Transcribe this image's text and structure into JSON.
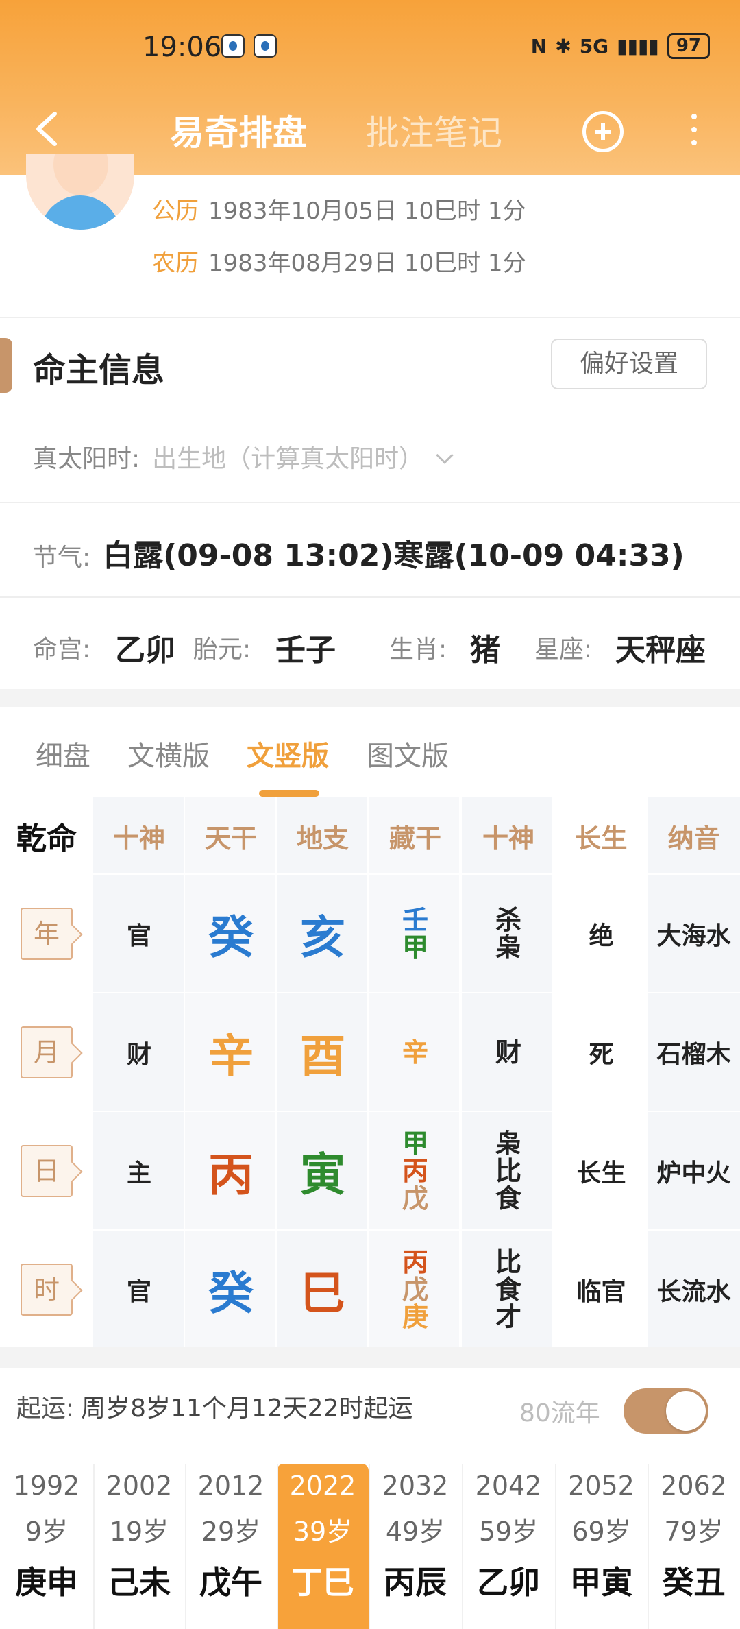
{
  "status_bar": {
    "time": "19:06",
    "network": "5G",
    "battery": "97"
  },
  "nav": {
    "tab_active": "易奇排盘",
    "tab_other": "批注笔记"
  },
  "profile": {
    "solar_label": "公历",
    "solar_value": "1983年10月05日 10巳时 1分",
    "lunar_label": "农历",
    "lunar_value": "1983年08月29日 10巳时 1分"
  },
  "section": {
    "title": "命主信息",
    "pref_button": "偏好设置"
  },
  "solar_time": {
    "label": "真太阳时:",
    "placeholder": "出生地（计算真太阳时）"
  },
  "jieqi": {
    "label": "节气:",
    "value": "白露(09-08 13:02)寒露(10-09 04:33)"
  },
  "info": {
    "minggong_label": "命宫:",
    "minggong": "乙卯",
    "taiyuan_label": "胎元:",
    "taiyuan": "壬子",
    "shengxiao_label": "生肖:",
    "shengxiao": "猪",
    "xingzuo_label": "星座:",
    "xingzuo": "天秤座"
  },
  "tabs": [
    "细盘",
    "文横版",
    "文竖版",
    "图文版"
  ],
  "grid": {
    "corner": "乾命",
    "headers": [
      "十神",
      "天干",
      "地支",
      "藏干",
      "十神",
      "长生",
      "纳音"
    ],
    "rows": [
      {
        "pillar": "年",
        "shishen": "官",
        "gan": "癸",
        "zhi": "亥",
        "canggan": [
          "壬",
          "甲"
        ],
        "shishen2": [
          "杀",
          "枭"
        ],
        "changsheng": "绝",
        "nayin": "大海水"
      },
      {
        "pillar": "月",
        "shishen": "财",
        "gan": "辛",
        "zhi": "酉",
        "canggan": [
          "辛"
        ],
        "shishen2": [
          "财"
        ],
        "changsheng": "死",
        "nayin": "石榴木"
      },
      {
        "pillar": "日",
        "shishen": "主",
        "gan": "丙",
        "zhi": "寅",
        "canggan": [
          "甲",
          "丙",
          "戊"
        ],
        "shishen2": [
          "枭",
          "比",
          "食"
        ],
        "changsheng": "长生",
        "nayin": "炉中火"
      },
      {
        "pillar": "时",
        "shishen": "官",
        "gan": "癸",
        "zhi": "巳",
        "canggan": [
          "丙",
          "戊",
          "庚"
        ],
        "shishen2": [
          "比",
          "食",
          "才"
        ],
        "changsheng": "临官",
        "nayin": "长流水"
      }
    ],
    "colors": {
      "water": "#2a7bd0",
      "metal": "#f0a03c",
      "fire": "#d4541c",
      "wood": "#2e8b2e",
      "earth": "#c7956a"
    }
  },
  "qiyun": {
    "label": "起运:",
    "value": "周岁8岁11个月12天22时起运",
    "liunian": "80流年"
  },
  "dayun": [
    {
      "year": "1992",
      "age": "9岁",
      "ganzhi": "庚申"
    },
    {
      "year": "2002",
      "age": "19岁",
      "ganzhi": "己未"
    },
    {
      "year": "2012",
      "age": "29岁",
      "ganzhi": "戊午"
    },
    {
      "year": "2022",
      "age": "39岁",
      "ganzhi": "丁巳"
    },
    {
      "year": "2032",
      "age": "49岁",
      "ganzhi": "丙辰"
    },
    {
      "year": "2042",
      "age": "59岁",
      "ganzhi": "乙卯"
    },
    {
      "year": "2052",
      "age": "69岁",
      "ganzhi": "甲寅"
    },
    {
      "year": "2062",
      "age": "79岁",
      "ganzhi": "癸丑"
    }
  ]
}
